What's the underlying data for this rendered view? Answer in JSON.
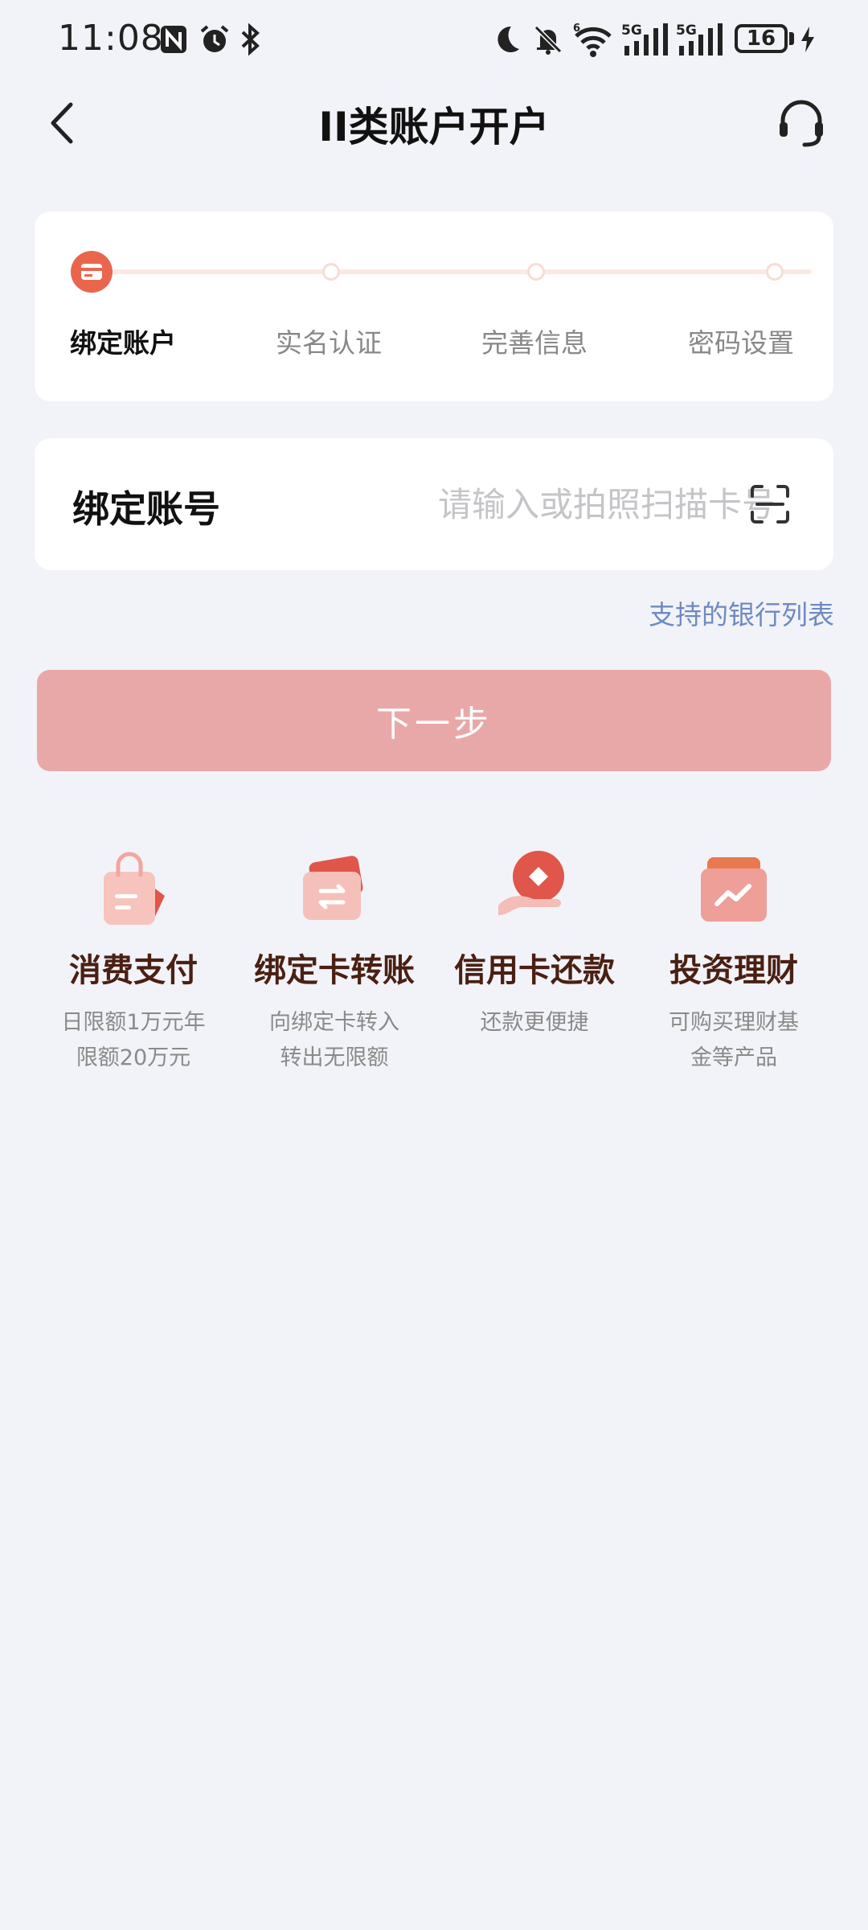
{
  "status_bar": {
    "time": "11:08",
    "battery": "16",
    "icons": [
      "nfc-icon",
      "alarm-icon",
      "bluetooth-icon",
      "moon-icon",
      "bell-off-icon",
      "wifi-icon",
      "signal-5g-icon",
      "signal-5g-icon",
      "battery-icon",
      "charging-icon"
    ]
  },
  "header": {
    "title": "II类账户开户",
    "back_icon": "back-arrow-icon",
    "support_icon": "headset-icon"
  },
  "steps": [
    {
      "label": "绑定账户",
      "active": true
    },
    {
      "label": "实名认证",
      "active": false
    },
    {
      "label": "完善信息",
      "active": false
    },
    {
      "label": "密码设置",
      "active": false
    }
  ],
  "account_field": {
    "label": "绑定账号",
    "value": "",
    "placeholder": "请输入或拍照扫描卡号"
  },
  "bank_list_link": "支持的银行列表",
  "next_button": "下一步",
  "features": [
    {
      "icon": "shopping-bag-icon",
      "title": "消费支付",
      "desc": "日限额1万元年\n限额20万元"
    },
    {
      "icon": "transfer-card-icon",
      "title": "绑定卡转账",
      "desc": "向绑定卡转入\n转出无限额"
    },
    {
      "icon": "coin-hand-icon",
      "title": "信用卡还款",
      "desc": "还款更便捷"
    },
    {
      "icon": "wallet-chart-icon",
      "title": "投资理财",
      "desc": "可购买理财基\n金等产品"
    }
  ],
  "colors": {
    "accent": "#e9664d",
    "button": "#e9a8a8",
    "link": "#6e8ac0",
    "feature_title": "#4a2013",
    "background": "#f2f3f8"
  }
}
